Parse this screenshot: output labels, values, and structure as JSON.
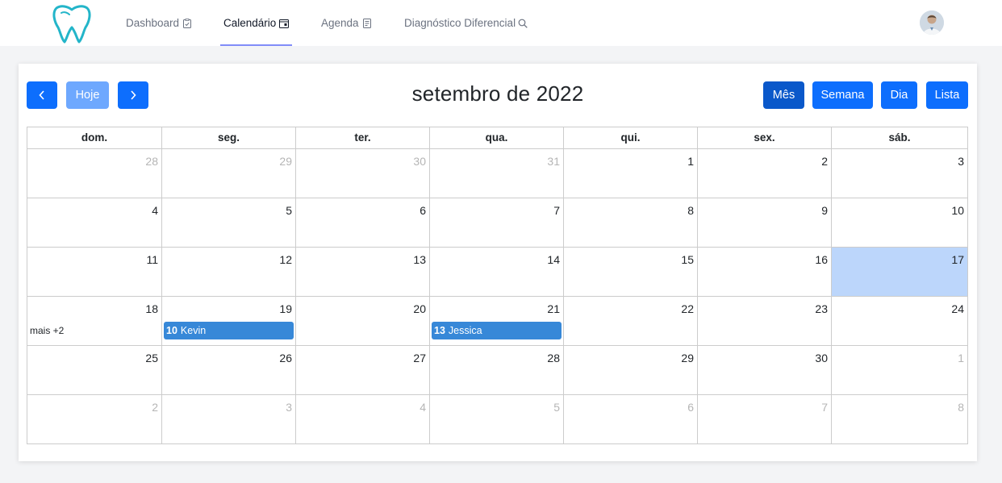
{
  "nav": {
    "items": [
      {
        "label": "Dashboard",
        "icon": "clipboard-check-icon"
      },
      {
        "label": "Calendário",
        "icon": "calendar-icon"
      },
      {
        "label": "Agenda",
        "icon": "journal-icon"
      },
      {
        "label": "Diagnóstico Diferencial",
        "icon": "search-icon"
      }
    ],
    "active": "Calendário",
    "accent": "#818cf8",
    "logo_icon": "tooth-logo-icon",
    "avatar_icon": "user-avatar-icon"
  },
  "toolbar": {
    "prev_icon": "chevron-left-icon",
    "today_label": "Hoje",
    "next_icon": "chevron-right-icon",
    "title": "setembro de 2022",
    "views": [
      "Mês",
      "Semana",
      "Dia",
      "Lista"
    ],
    "active_view": "Mês",
    "button_color": "#0d6efd"
  },
  "calendar": {
    "weekdays": [
      "dom.",
      "seg.",
      "ter.",
      "qua.",
      "qui.",
      "sex.",
      "sáb."
    ],
    "today_color": "#bcd6fb",
    "event_color": "#3788d8",
    "weeks": [
      [
        {
          "d": "28",
          "other": true
        },
        {
          "d": "29",
          "other": true
        },
        {
          "d": "30",
          "other": true
        },
        {
          "d": "31",
          "other": true
        },
        {
          "d": "1"
        },
        {
          "d": "2"
        },
        {
          "d": "3"
        }
      ],
      [
        {
          "d": "4"
        },
        {
          "d": "5"
        },
        {
          "d": "6"
        },
        {
          "d": "7"
        },
        {
          "d": "8"
        },
        {
          "d": "9"
        },
        {
          "d": "10"
        }
      ],
      [
        {
          "d": "11"
        },
        {
          "d": "12"
        },
        {
          "d": "13"
        },
        {
          "d": "14"
        },
        {
          "d": "15"
        },
        {
          "d": "16"
        },
        {
          "d": "17",
          "today": true
        }
      ],
      [
        {
          "d": "18",
          "more": "mais +2"
        },
        {
          "d": "19",
          "event": {
            "time": "10",
            "title": "Kevin"
          }
        },
        {
          "d": "20"
        },
        {
          "d": "21",
          "event": {
            "time": "13",
            "title": "Jessica"
          }
        },
        {
          "d": "22"
        },
        {
          "d": "23"
        },
        {
          "d": "24"
        }
      ],
      [
        {
          "d": "25"
        },
        {
          "d": "26"
        },
        {
          "d": "27"
        },
        {
          "d": "28"
        },
        {
          "d": "29"
        },
        {
          "d": "30"
        },
        {
          "d": "1",
          "other": true
        }
      ],
      [
        {
          "d": "2",
          "other": true
        },
        {
          "d": "3",
          "other": true
        },
        {
          "d": "4",
          "other": true
        },
        {
          "d": "5",
          "other": true
        },
        {
          "d": "6",
          "other": true
        },
        {
          "d": "7",
          "other": true
        },
        {
          "d": "8",
          "other": true
        }
      ]
    ]
  }
}
